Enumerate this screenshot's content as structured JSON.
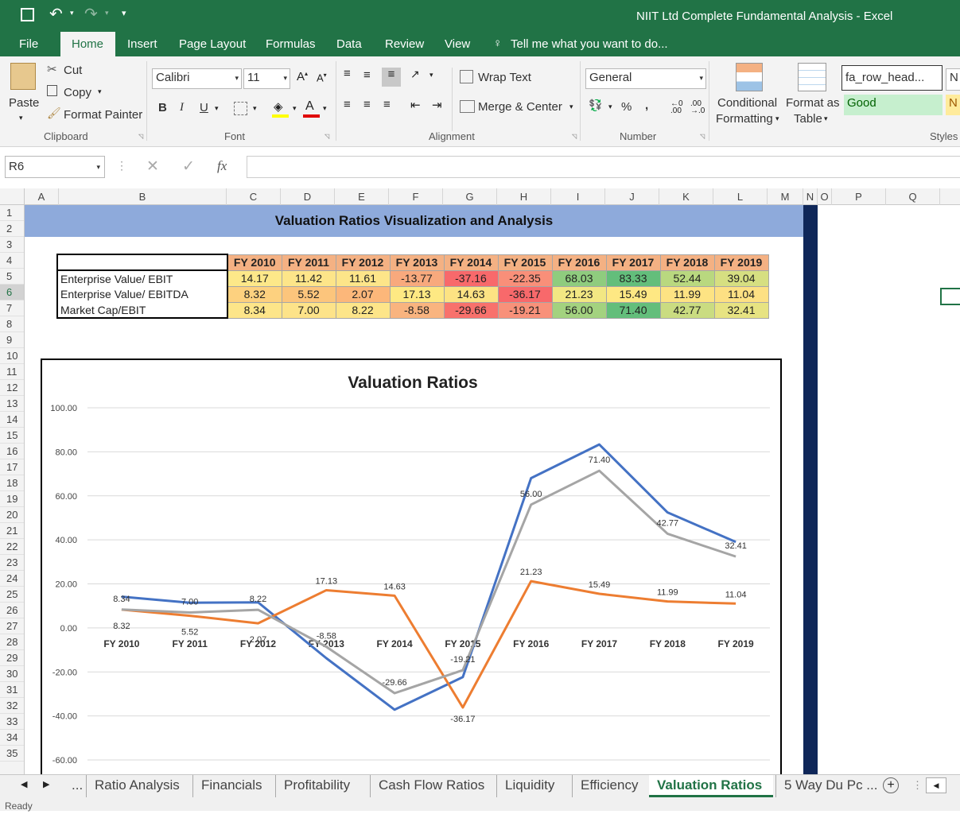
{
  "window": {
    "title": "NIIT Ltd Complete Fundamental Analysis - Excel"
  },
  "ribbon_tabs": [
    "File",
    "Home",
    "Insert",
    "Page Layout",
    "Formulas",
    "Data",
    "Review",
    "View"
  ],
  "tell_me": "Tell me what you want to do...",
  "clipboard": {
    "paste": "Paste",
    "cut": "Cut",
    "copy": "Copy",
    "format_painter": "Format Painter",
    "group": "Clipboard"
  },
  "font": {
    "name": "Calibri",
    "size": "11",
    "group": "Font",
    "bold": "B",
    "italic": "I",
    "underline": "U"
  },
  "alignment": {
    "wrap": "Wrap Text",
    "merge": "Merge & Center",
    "group": "Alignment"
  },
  "number": {
    "format": "General",
    "group": "Number",
    "percent": "%",
    "comma": ","
  },
  "styles": {
    "conditional_1": "Conditional",
    "conditional_2": "Formatting",
    "format_as_1": "Format as",
    "format_as_2": "Table",
    "style_name": "fa_row_head...",
    "style_good": "Good",
    "style_next": "N",
    "style_next2": "N",
    "group": "Styles"
  },
  "formula_bar": {
    "name_box": "R6",
    "fx": "fx",
    "value": ""
  },
  "columns": [
    "A",
    "B",
    "C",
    "D",
    "E",
    "F",
    "G",
    "H",
    "I",
    "J",
    "K",
    "L",
    "M",
    "N",
    "O",
    "P",
    "Q"
  ],
  "rows": [
    "1",
    "2",
    "3",
    "4",
    "5",
    "6",
    "7",
    "8",
    "9",
    "10",
    "11",
    "12",
    "13",
    "14",
    "15",
    "16",
    "17",
    "18",
    "19",
    "20",
    "21",
    "22",
    "23",
    "24",
    "25",
    "26",
    "27",
    "28",
    "29",
    "30",
    "31",
    "32",
    "33",
    "34",
    "35"
  ],
  "sheet": {
    "banner": "Valuation Ratios Visualization and Analysis",
    "years": [
      "FY 2010",
      "FY 2011",
      "FY 2012",
      "FY 2013",
      "FY 2014",
      "FY 2015",
      "FY 2016",
      "FY 2017",
      "FY 2018",
      "FY 2019"
    ],
    "table_rows": [
      {
        "label": "Enterprise Value/ EBIT",
        "values": [
          "14.17",
          "11.42",
          "11.61",
          "-13.77",
          "-37.16",
          "-22.35",
          "68.03",
          "83.33",
          "52.44",
          "39.04"
        ],
        "colors": [
          "#fde889",
          "#fde589",
          "#fde589",
          "#f8a97d",
          "#f8696b",
          "#f98f79",
          "#8fcc7e",
          "#63be7b",
          "#b9d87f",
          "#d6df81"
        ]
      },
      {
        "label": "Enterprise Value/ EBITDA",
        "values": [
          "8.32",
          "5.52",
          "2.07",
          "17.13",
          "14.63",
          "-36.17",
          "21.23",
          "15.49",
          "11.99",
          "11.04"
        ],
        "colors": [
          "#fdd17f",
          "#fcc57c",
          "#fcb77a",
          "#fee983",
          "#fde383",
          "#f8696b",
          "#f2e783",
          "#fee883",
          "#fde383",
          "#fde083"
        ]
      },
      {
        "label": "Market Cap/EBIT",
        "values": [
          "8.34",
          "7.00",
          "8.22",
          "-8.58",
          "-29.66",
          "-19.21",
          "56.00",
          "71.40",
          "42.77",
          "32.41"
        ],
        "colors": [
          "#fde589",
          "#fde389",
          "#fde589",
          "#f9b47f",
          "#f8716c",
          "#f8917a",
          "#a3d27f",
          "#63be7b",
          "#cadc81",
          "#e7e382"
        ]
      }
    ]
  },
  "chart_data": {
    "type": "line",
    "title": "Valuation Ratios",
    "categories": [
      "FY 2010",
      "FY 2011",
      "FY 2012",
      "FY 2013",
      "FY 2014",
      "FY 2015",
      "FY 2016",
      "FY 2017",
      "FY 2018",
      "FY 2019"
    ],
    "ylim": [
      -60,
      100
    ],
    "yticks": [
      "100.00",
      "80.00",
      "60.00",
      "40.00",
      "20.00",
      "0.00",
      "-20.00",
      "-40.00",
      "-60.00"
    ],
    "grid": true,
    "series": [
      {
        "color": "#4472c4",
        "values": [
          14.17,
          11.42,
          11.61,
          -13.77,
          -37.16,
          -22.35,
          68.03,
          83.33,
          52.44,
          39.04
        ]
      },
      {
        "color": "#ed7d31",
        "values": [
          8.32,
          5.52,
          2.07,
          17.13,
          14.63,
          -36.17,
          21.23,
          15.49,
          11.99,
          11.04
        ]
      },
      {
        "color": "#a5a5a5",
        "values": [
          8.34,
          7.0,
          8.22,
          -8.58,
          -29.66,
          -19.21,
          56.0,
          71.4,
          42.77,
          32.41
        ]
      }
    ],
    "data_labels": [
      {
        "series": 2,
        "labels": [
          "8.34",
          "7.00",
          "8.22",
          "-8.58",
          "-29.66",
          "-19.21",
          "56.00",
          "71.40",
          "42.77",
          "32.41"
        ]
      },
      {
        "series": 1,
        "labels": [
          "8.32",
          "5.52",
          "2.07",
          "17.13",
          "14.63",
          "-36.17",
          "21.23",
          "15.49",
          "11.99",
          "11.04"
        ]
      }
    ]
  },
  "sheet_tabs": [
    "...",
    "Ratio Analysis",
    "Financials",
    "Profitability",
    "Cash Flow Ratios",
    "Liquidity",
    "Efficiency",
    "Valuation Ratios",
    "5 Way Du Pc ..."
  ],
  "active_sheet": "Valuation Ratios",
  "status": "Ready"
}
